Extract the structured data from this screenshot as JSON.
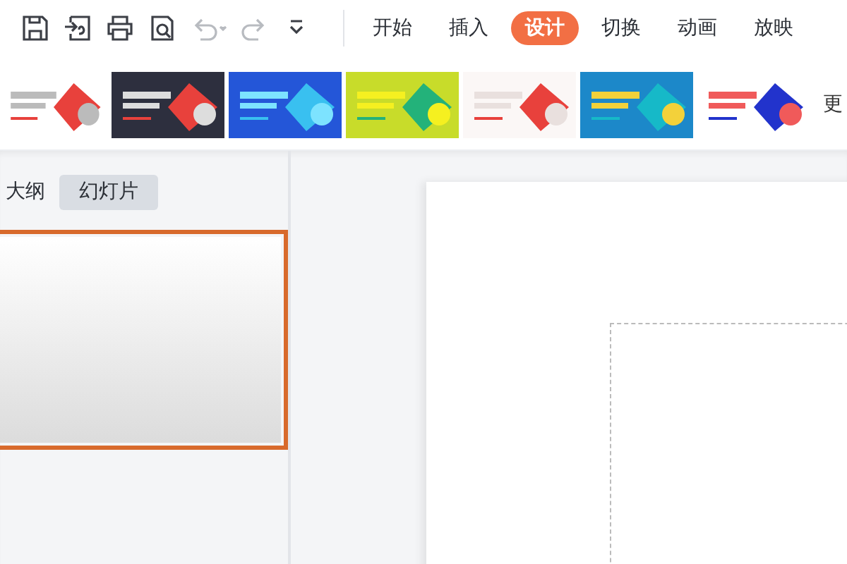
{
  "undo": {
    "disabled": true
  },
  "redo": {
    "disabled": true
  },
  "ribbon_tabs": [
    {
      "label": "开始",
      "selected": false
    },
    {
      "label": "插入",
      "selected": false
    },
    {
      "label": "设计",
      "selected": true
    },
    {
      "label": "切换",
      "selected": false
    },
    {
      "label": "动画",
      "selected": false
    },
    {
      "label": "放映",
      "selected": false
    }
  ],
  "more_label": "更",
  "view_tabs": [
    {
      "label": "大纲",
      "selected": false
    },
    {
      "label": "幻灯片",
      "selected": true
    }
  ],
  "slides": [
    {
      "selected": true
    }
  ]
}
